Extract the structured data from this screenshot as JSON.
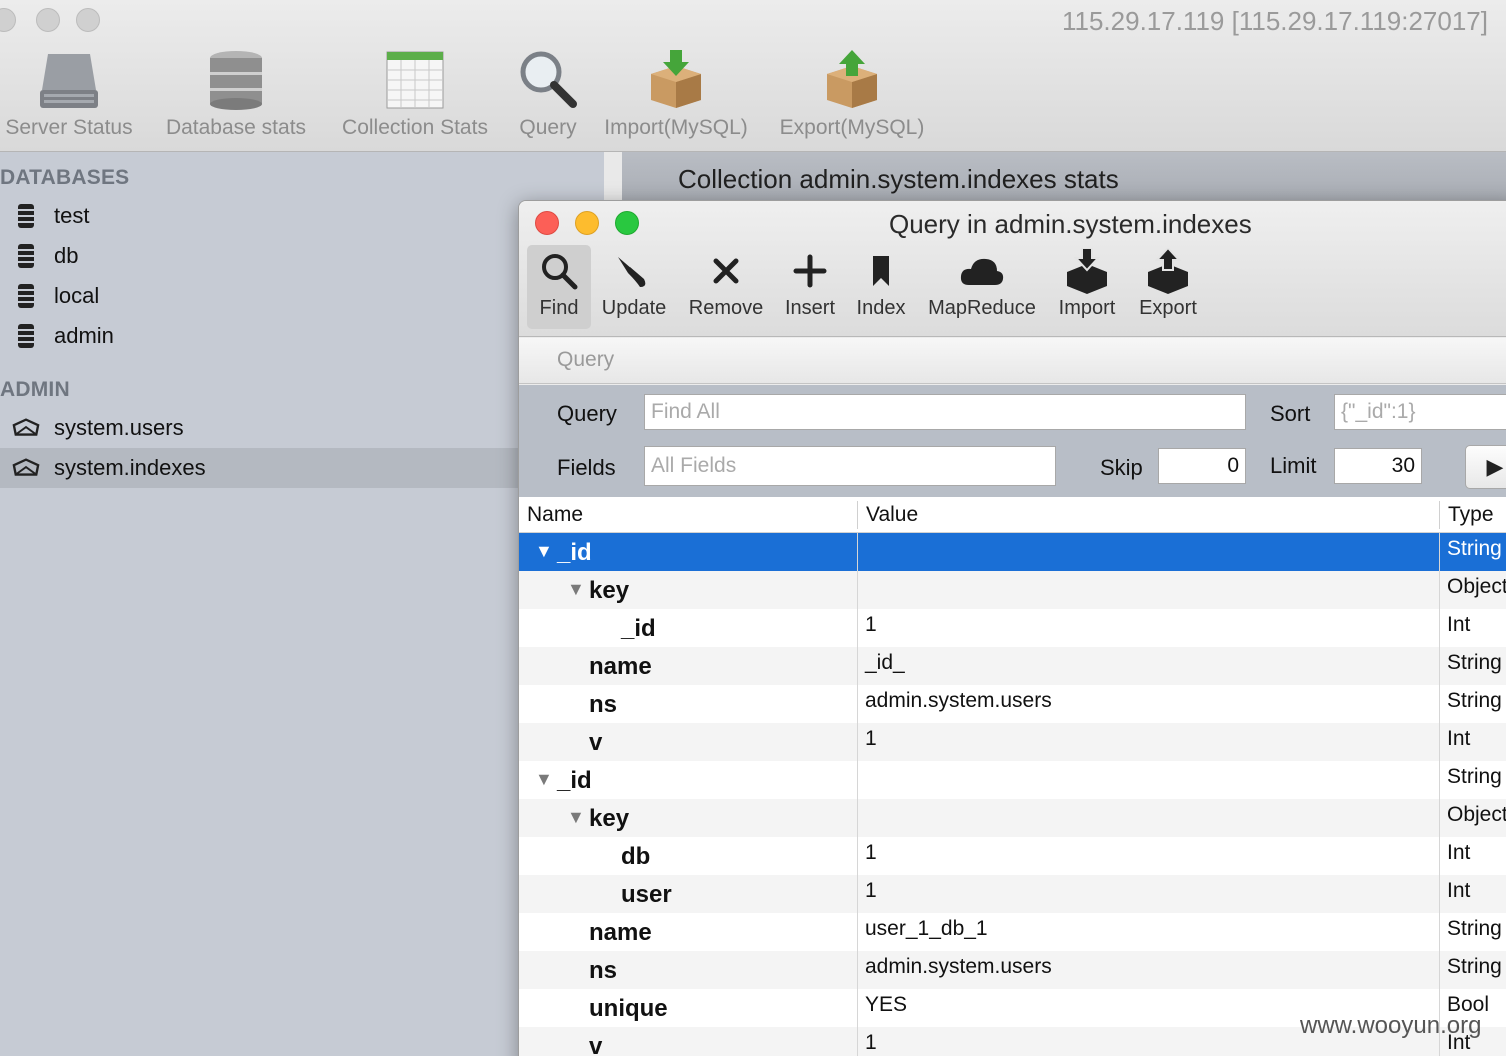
{
  "window": {
    "title": "115.29.17.119 [115.29.17.119:27017]"
  },
  "toolbar": [
    {
      "label": "Server Status",
      "icon": "server-icon"
    },
    {
      "label": "Database stats",
      "icon": "database-icon"
    },
    {
      "label": "Collection Stats",
      "icon": "table-icon"
    },
    {
      "label": "Query",
      "icon": "magnifier-icon"
    },
    {
      "label": "Import(MySQL)",
      "icon": "box-import-icon"
    },
    {
      "label": "Export(MySQL)",
      "icon": "box-export-icon"
    }
  ],
  "sidebar": {
    "databases_heading": "DATABASES",
    "databases": [
      {
        "label": "test",
        "icon": "database-icon"
      },
      {
        "label": "db",
        "icon": "database-icon"
      },
      {
        "label": "local",
        "icon": "database-icon"
      },
      {
        "label": "admin",
        "icon": "database-icon"
      }
    ],
    "admin_heading": "ADMIN",
    "collections": [
      {
        "label": "system.users",
        "icon": "collection-icon"
      },
      {
        "label": "system.indexes",
        "icon": "collection-icon",
        "selected": true
      }
    ]
  },
  "stats_header": "Collection admin.system.indexes stats",
  "query_window": {
    "title": "Query in admin.system.indexes",
    "toolbar": [
      {
        "label": "Find",
        "icon": "search-icon",
        "active": true
      },
      {
        "label": "Update",
        "icon": "brush-icon"
      },
      {
        "label": "Remove",
        "icon": "x-icon"
      },
      {
        "label": "Insert",
        "icon": "plus-icon"
      },
      {
        "label": "Index",
        "icon": "bookmark-icon"
      },
      {
        "label": "MapReduce",
        "icon": "cloud-icon"
      },
      {
        "label": "Import",
        "icon": "import-box-icon"
      },
      {
        "label": "Export",
        "icon": "export-box-icon"
      }
    ],
    "section_label": "Query",
    "form": {
      "query_label": "Query",
      "query_placeholder": "Find All",
      "sort_label": "Sort",
      "sort_placeholder": "{\"_id\":1}",
      "fields_label": "Fields",
      "fields_placeholder": "All Fields",
      "skip_label": "Skip",
      "skip_value": "0",
      "limit_label": "Limit",
      "limit_value": "30",
      "run_glyph": "▶"
    },
    "table": {
      "headers": [
        "Name",
        "Value",
        "Type"
      ],
      "rows": [
        {
          "name": "_id",
          "value": "",
          "type": "String",
          "depth": 0,
          "expanded": true,
          "selected": true
        },
        {
          "name": "key",
          "value": "",
          "type": "Object",
          "depth": 1,
          "expanded": true
        },
        {
          "name": "_id",
          "value": "1",
          "type": "Int",
          "depth": 2
        },
        {
          "name": "name",
          "value": "_id_",
          "type": "String",
          "depth": 1
        },
        {
          "name": "ns",
          "value": "admin.system.users",
          "type": "String",
          "depth": 1
        },
        {
          "name": "v",
          "value": "1",
          "type": "Int",
          "depth": 1
        },
        {
          "name": "_id",
          "value": "",
          "type": "String",
          "depth": 0,
          "expanded": true
        },
        {
          "name": "key",
          "value": "",
          "type": "Object",
          "depth": 1,
          "expanded": true
        },
        {
          "name": "db",
          "value": "1",
          "type": "Int",
          "depth": 2
        },
        {
          "name": "user",
          "value": "1",
          "type": "Int",
          "depth": 2
        },
        {
          "name": "name",
          "value": "user_1_db_1",
          "type": "String",
          "depth": 1
        },
        {
          "name": "ns",
          "value": "admin.system.users",
          "type": "String",
          "depth": 1
        },
        {
          "name": "unique",
          "value": "YES",
          "type": "Bool",
          "depth": 1
        },
        {
          "name": "v",
          "value": "1",
          "type": "Int",
          "depth": 1
        }
      ]
    }
  },
  "watermark": "www.wooyun.org",
  "colors": {
    "selection": "#1a6fd6",
    "sidebar": "#c6cbd4",
    "close": "#fc5f57",
    "minimize": "#fdbc2e",
    "zoom": "#29c840"
  }
}
